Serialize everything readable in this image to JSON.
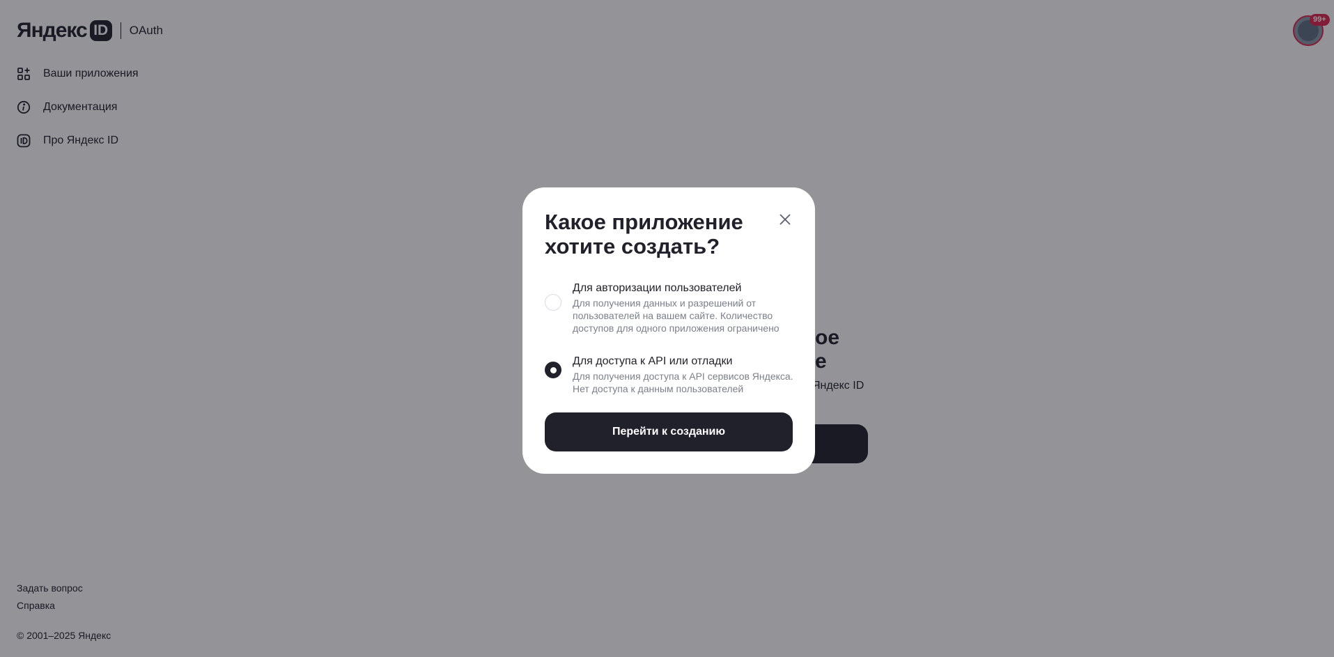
{
  "header": {
    "logo_word": "Яндекс",
    "logo_id": "ID",
    "service": "OAuth"
  },
  "nav": {
    "items": [
      {
        "label": "Ваши приложения",
        "icon": "apps-grid-icon"
      },
      {
        "label": "Документация",
        "icon": "info-icon"
      },
      {
        "label": "Про Яндекс ID",
        "icon": "id-badge-icon"
      }
    ]
  },
  "user": {
    "badge": "99+"
  },
  "empty_state": {
    "title_fragment": "ое\nе",
    "subtitle_fragment": "Яндекс ID"
  },
  "footer": {
    "links": [
      "Задать вопрос",
      "Справка"
    ],
    "copyright": "© 2001–2025 Яндекс"
  },
  "modal": {
    "title": "Какое приложение хотите создать?",
    "options": [
      {
        "title": "Для авторизации пользователей",
        "description": "Для получения данных и разрешений от пользователей на вашем сайте. Количество доступов для одного приложения ограничено",
        "checked": false
      },
      {
        "title": "Для доступа к API или отладки",
        "description": "Для получения доступа к API сервисов Яндекса. Нет доступа к данным пользователей",
        "checked": true
      }
    ],
    "submit_label": "Перейти к созданию"
  },
  "colors": {
    "accent_dark": "#21212b",
    "badge_red": "#e2244a",
    "muted_text": "#7b7f8a"
  }
}
